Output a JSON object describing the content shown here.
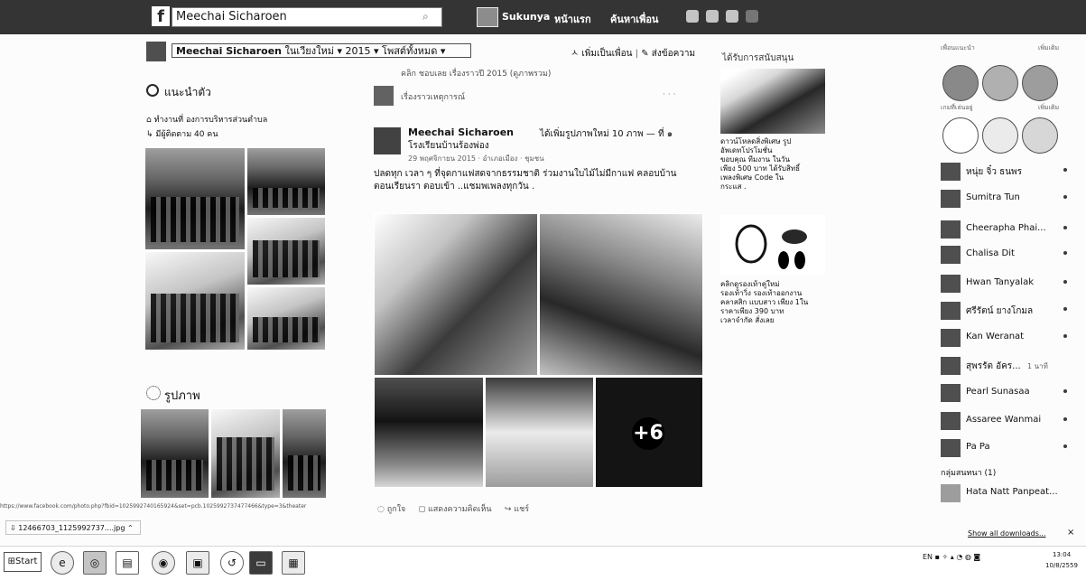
{
  "topbar": {
    "logo": "f",
    "search_value": "Meechai Sicharoen",
    "user_name": "Sukunya",
    "home": "หน้าแรก",
    "find_friends": "ค้นหาเพื่อน"
  },
  "profile_header": {
    "name": "Meechai Sicharoen",
    "location": "ในเวียงใหม่ ▾",
    "year": "2015 ▾",
    "album": "โพสต์ทั้งหมด ▾",
    "add_friend": "ㅅ เพิ่มเป็นเพื่อน",
    "message": "✎ ส่งข้อความ",
    "timeline_sub": "คลิก  ชอบเลย  เรื่องราวปี 2015 (ดูภาพรวม)"
  },
  "intro": {
    "title": "แนะนำตัว",
    "items": [
      "ทำงานที่ องการบริหารส่วนตำบล",
      "มีผู้ติดตาม 40 คน"
    ]
  },
  "photos": {
    "title": "รูปภาพ"
  },
  "post": {
    "recommended": "เรื่องราวเหตุการณ์",
    "recommended_more": "· · ·",
    "name": "Meechai Sicharoen",
    "with": "ได้เพิ่มรูปภาพใหม่ 10 ภาพ — ที่ ๑",
    "place": "โรงเรียนบ้านร้องพ่อง",
    "meta": "29 พฤศจิกายน 2015 · อำเภอเมือง · ชุมชน",
    "body": "ปลดทุก เวลา ๆ ที่จุดกาแฟสดจากธรรมชาติ ร่วมงานใบไม้ไม่มีกาแฟ คลอบบ้าน ตอนเรียนรา ตอบเข้า ..แชมพเพลงทุกวัน .",
    "more_count": "+6",
    "actions": [
      "ถูกใจ",
      "แสดงความคิดเห็น",
      "แชร์"
    ]
  },
  "ads": {
    "title": "ได้รับการสนับสนุน",
    "ad1": "ดาวน์โหลดสิ่งพิเศษ รูป\nอัพเดทโปรโมชั่น\nขอบคุณ ทีมงาน ในวัน\nเพียง 500 บาท ได้รับสิทธิ์\nเพลงพิเศษ Code ใน\nกระแส .",
    "ad2": "คลิกดูรองเท้าคู่ใหม่\nรองเท้าวิ่ง รองเท้าออกงาน\nคลาสสิก แบบสาว เพียง 1ใน\nราคาเพียง 390 บาท\nเวลาจำกัด สั่งเลย"
  },
  "chat": {
    "top_label": "เพื่อนแนะนำ",
    "top_right": "เพิ่มเติม",
    "mid_label": "เกมที่เล่นอยู่",
    "mid_right": "เพิ่มเติม",
    "contacts": [
      "หนุ่ย จิ๋ว ธนพร",
      "Sumitra Tun",
      "Cheerapha Phai...",
      "Chalisa Dit",
      "Hwan Tanyalak",
      "ศรีรัตน์ ยางโกมล",
      "Kan Weranat",
      "สุพรรัต อัคร...",
      "Pearl Sunasaa",
      "Assaree Wanmai",
      "Pa Pa"
    ],
    "contacts_extra": "1 นาที",
    "group_label": "กลุ่มสนทนา (1)",
    "group_item": "Hata Natt Panpeat..."
  },
  "status_bar": {
    "url": "https://www.facebook.com/photo.php?fbid=1025992740165924&set=pcb.1025992737477466&type=3&theater"
  },
  "downloads": {
    "file": "12466703_1125992737....jpg",
    "show_all": "Show all downloads...",
    "close": "×"
  },
  "taskbar": {
    "start": "Start",
    "lang": "EN",
    "time": "13:04",
    "date": "10/8/2559"
  }
}
